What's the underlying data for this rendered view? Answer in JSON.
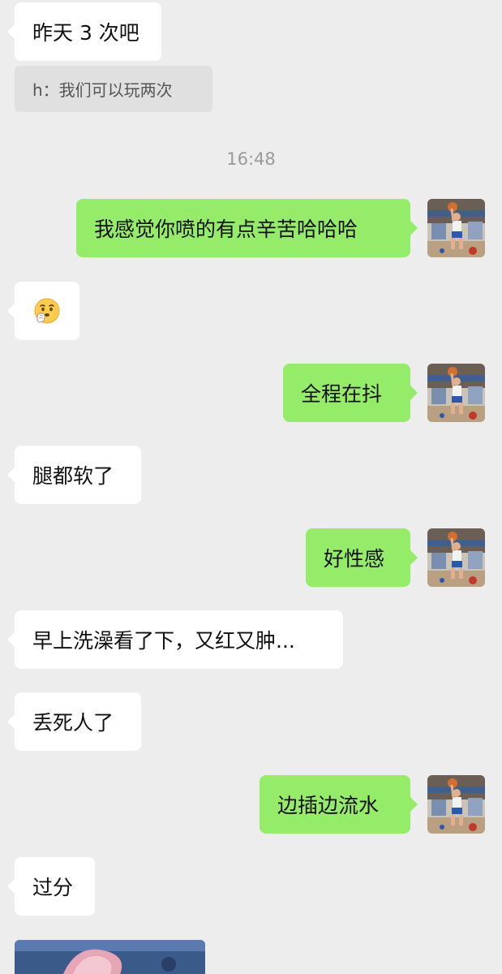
{
  "messages": [
    {
      "side": "in",
      "text": "昨天 3 次吧"
    },
    {
      "quote": "h：我们可以玩两次"
    },
    {
      "timestamp": "16:48"
    },
    {
      "side": "out",
      "text": "我感觉你喷的有点辛苦哈哈哈"
    },
    {
      "side": "in",
      "emoji": "face-with-hand-over-mouth-emoji"
    },
    {
      "side": "out",
      "text": "全程在抖"
    },
    {
      "side": "in",
      "text": "腿都软了"
    },
    {
      "side": "out",
      "text": "好性感"
    },
    {
      "side": "in",
      "text": "早上洗澡看了下，又红又肿..."
    },
    {
      "side": "in",
      "text": "丢死人了"
    },
    {
      "side": "out",
      "text": "边插边流水"
    },
    {
      "side": "in",
      "text": "过分"
    },
    {
      "side": "in",
      "image": "cartoon-photo-partial"
    }
  ],
  "colors": {
    "background": "#ededed",
    "incoming_bubble": "#ffffff",
    "outgoing_bubble": "#95ec69",
    "quote_background": "#e0e0e0",
    "timestamp_text": "#9a9a9a"
  },
  "icons": {
    "avatar": "basketball-player-avatar",
    "emoji": "face-with-hand-over-mouth-emoji"
  }
}
